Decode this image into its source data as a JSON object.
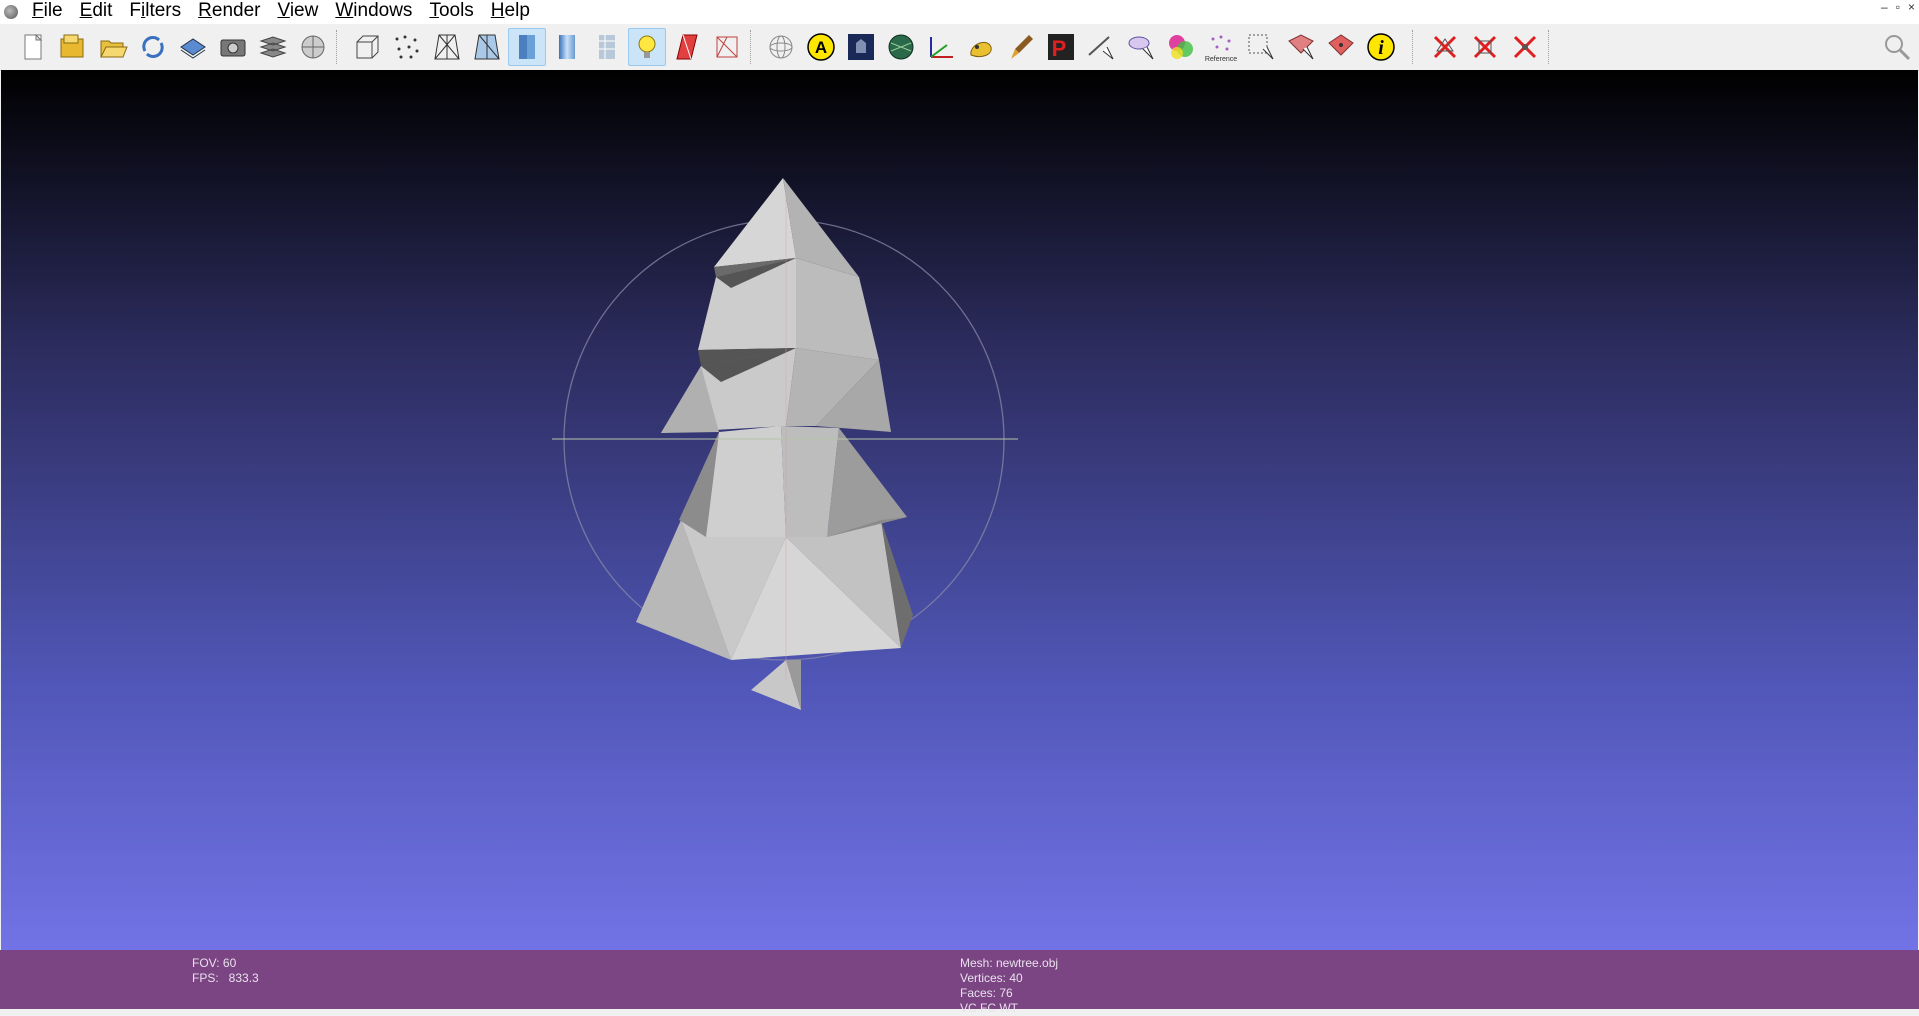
{
  "menu": {
    "items": [
      {
        "pre": "",
        "ul": "F",
        "post": "ile"
      },
      {
        "pre": "",
        "ul": "E",
        "post": "dit"
      },
      {
        "pre": "F",
        "ul": "i",
        "post": "lters"
      },
      {
        "pre": "",
        "ul": "R",
        "post": "ender"
      },
      {
        "pre": "",
        "ul": "V",
        "post": "iew"
      },
      {
        "pre": "",
        "ul": "W",
        "post": "indows"
      },
      {
        "pre": "",
        "ul": "T",
        "post": "ools"
      },
      {
        "pre": "",
        "ul": "H",
        "post": "elp"
      }
    ]
  },
  "window_controls": {
    "minimize": "–",
    "restore": "▫",
    "close": "×"
  },
  "toolbar": {
    "reference_label": "Reference",
    "info_glyph": "i",
    "annotation_glyph": "A",
    "pp_glyph": "P",
    "tools": [
      "new-project-icon",
      "open-project-icon",
      "open-mesh-icon",
      "reload-icon",
      "save-icon",
      "snapshot-icon",
      "layers-icon",
      "globe-settings-icon",
      "bounding-box-icon",
      "points-icon",
      "wireframe-icon",
      "hidden-lines-icon",
      "flat-shading-icon",
      "smooth-shading-icon",
      "texture-icon",
      "light-icon",
      "backface-icon",
      "selected-faces-icon",
      "trackball-icon",
      "annotation-icon",
      "scene-icon",
      "texture-map-icon",
      "axes-icon",
      "paint-icon",
      "brush-icon",
      "pp-icon",
      "measure-icon",
      "align-icon",
      "color-icon",
      "reference-icon",
      "select-icon",
      "select-faces-icon",
      "select-vertices-icon",
      "info-icon",
      "delete-faces-icon",
      "delete-selection-icon",
      "delete-vertices-icon"
    ],
    "active": [
      "flat-shading-icon",
      "light-icon"
    ]
  },
  "search_icon": "search-icon",
  "colors": {
    "viewport_top": "#000000",
    "viewport_bottom": "#7273e6",
    "status_bg": "#7b4483",
    "mesh_light": "#d4d4d4",
    "mesh_dark": "#5e5e5e"
  },
  "status": {
    "fov": "FOV: 60",
    "fps": "FPS:   833.3",
    "mesh": "Mesh: newtree.obj",
    "vertices": "Vertices: 40",
    "faces": "Faces: 76",
    "extra": "VC FC WT"
  }
}
